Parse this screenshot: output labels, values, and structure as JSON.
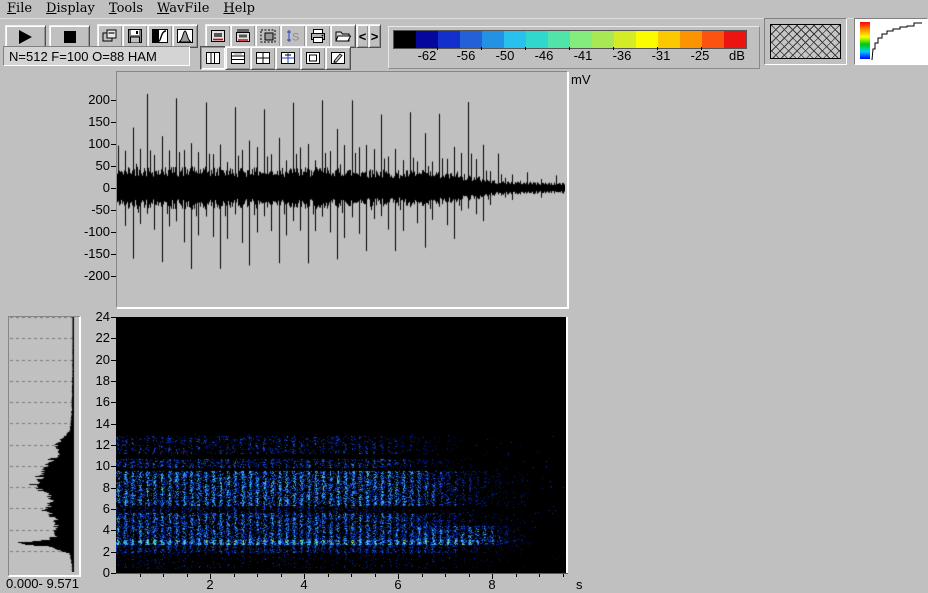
{
  "window": {
    "background": "#c0c0c0"
  },
  "menu": {
    "items": [
      "File",
      "Display",
      "Tools",
      "WavFile",
      "Help"
    ]
  },
  "toolbar": {
    "status_text": "N=512 F=100 O=88 HAM",
    "scroll_left_glyph": "<",
    "scroll_right_glyph": ">",
    "scale_letter": "S"
  },
  "colorbar": {
    "unit": "dB",
    "labels": [
      "-62",
      "-56",
      "-50",
      "-46",
      "-41",
      "-36",
      "-31",
      "-25"
    ],
    "colors": [
      "#000000",
      "#04089c",
      "#1430cc",
      "#2460d8",
      "#2492e4",
      "#28c0ec",
      "#30d8cc",
      "#50e4a8",
      "#84ec7c",
      "#a8e854",
      "#d4ec28",
      "#fcfc00",
      "#fcc800",
      "#fc9400",
      "#fc5410",
      "#ec1410"
    ]
  },
  "waveform": {
    "unit": "mV",
    "y_ticks": [
      "200",
      "150",
      "100",
      "50",
      "0",
      "-50",
      "-100",
      "-150",
      "-200"
    ],
    "x_range_s": [
      0,
      9.571
    ],
    "spike_period_s": 0.156,
    "envelope": {
      "t": [
        0,
        0.15,
        0.35,
        0.8,
        1.5,
        2.5,
        3.5,
        4.5,
        5.3,
        6.0,
        6.6,
        7.1,
        7.6,
        8.0,
        8.4,
        8.9,
        9.571
      ],
      "pos": [
        90,
        180,
        235,
        195,
        200,
        195,
        192,
        205,
        185,
        155,
        195,
        150,
        205,
        95,
        45,
        32,
        26
      ],
      "neg": [
        70,
        150,
        175,
        185,
        190,
        185,
        172,
        168,
        158,
        142,
        150,
        118,
        108,
        55,
        30,
        24,
        20
      ],
      "body": [
        38,
        46,
        50,
        46,
        47,
        45,
        44,
        46,
        42,
        39,
        39,
        34,
        28,
        18,
        15,
        13,
        11
      ]
    }
  },
  "spectrogram": {
    "y_unit_khz": true,
    "y_ticks": [
      "24",
      "22",
      "20",
      "18",
      "16",
      "14",
      "12",
      "10",
      "8",
      "6",
      "4",
      "2",
      "0"
    ],
    "x_ticks": [
      "2",
      "4",
      "6",
      "8"
    ],
    "x_unit": "s",
    "x_max": 9.571,
    "y_max": 24,
    "striation_period_s": 0.156,
    "palette": [
      "#000014",
      "#04125e",
      "#0a2496",
      "#0d36c0",
      "#1553d8",
      "#2373e8",
      "#2f96f2",
      "#3ab9ee",
      "#44d8d0",
      "#6fe89a",
      "#c0e84a"
    ],
    "bands": [
      {
        "f": [
          0.4,
          1.9
        ],
        "t": [
          0,
          8.6
        ],
        "fade": 6.5,
        "d": 0.12,
        "i": 0.35,
        "ph": 0
      },
      {
        "f": [
          1.9,
          2.6
        ],
        "t": [
          0,
          8.8
        ],
        "fade": 6.8,
        "d": 0.45,
        "i": 0.55,
        "ph": 0.5
      },
      {
        "f": [
          2.6,
          3.05
        ],
        "t": [
          0,
          8.9
        ],
        "fade": 7.6,
        "d": 0.95,
        "i": 1.0,
        "ph": 0
      },
      {
        "f": [
          3.1,
          5.6
        ],
        "t": [
          0,
          8.7
        ],
        "fade": 5.8,
        "d": 0.62,
        "i": 0.75,
        "ph": 0
      },
      {
        "f": [
          5.6,
          6.3
        ],
        "t": [
          0,
          6.6
        ],
        "fade": 5.0,
        "d": 0.28,
        "i": 0.45,
        "ph": 1.0
      },
      {
        "f": [
          6.3,
          9.6
        ],
        "t": [
          0,
          8.8
        ],
        "fade": 6.1,
        "d": 0.66,
        "i": 0.85,
        "ph": 0
      },
      {
        "f": [
          9.8,
          10.7
        ],
        "t": [
          0,
          7.6
        ],
        "fade": 5.8,
        "d": 0.42,
        "i": 0.6,
        "ph": 0.3
      },
      {
        "f": [
          11.2,
          12.8
        ],
        "t": [
          0,
          7.4
        ],
        "fade": 5.5,
        "d": 0.28,
        "i": 0.5,
        "ph": 0.6
      },
      {
        "f": [
          3.0,
          4.4
        ],
        "t": [
          6.3,
          8.7
        ],
        "fade": 7.8,
        "d": 0.5,
        "i": 0.8,
        "ph": 0.2
      }
    ]
  },
  "spectrum_panel": {
    "range_label": "0.000- 9.571",
    "points": [
      [
        0,
        0.03
      ],
      [
        1.0,
        0.04
      ],
      [
        1.8,
        0.07
      ],
      [
        2.2,
        0.3
      ],
      [
        2.5,
        0.5
      ],
      [
        2.8,
        0.94
      ],
      [
        3.0,
        0.5
      ],
      [
        3.4,
        0.3
      ],
      [
        4.0,
        0.3
      ],
      [
        4.6,
        0.27
      ],
      [
        5.2,
        0.33
      ],
      [
        5.8,
        0.47
      ],
      [
        6.2,
        0.42
      ],
      [
        6.8,
        0.33
      ],
      [
        7.4,
        0.42
      ],
      [
        7.9,
        0.55
      ],
      [
        8.2,
        0.66
      ],
      [
        8.6,
        0.52
      ],
      [
        9.0,
        0.58
      ],
      [
        9.5,
        0.48
      ],
      [
        10.0,
        0.44
      ],
      [
        10.4,
        0.42
      ],
      [
        10.8,
        0.32
      ],
      [
        11.3,
        0.26
      ],
      [
        11.9,
        0.3
      ],
      [
        12.4,
        0.22
      ],
      [
        12.9,
        0.12
      ],
      [
        13.4,
        0.07
      ],
      [
        14.0,
        0.05
      ],
      [
        15.0,
        0.04
      ],
      [
        17.0,
        0.03
      ],
      [
        20.0,
        0.025
      ],
      [
        24,
        0.02
      ]
    ]
  }
}
